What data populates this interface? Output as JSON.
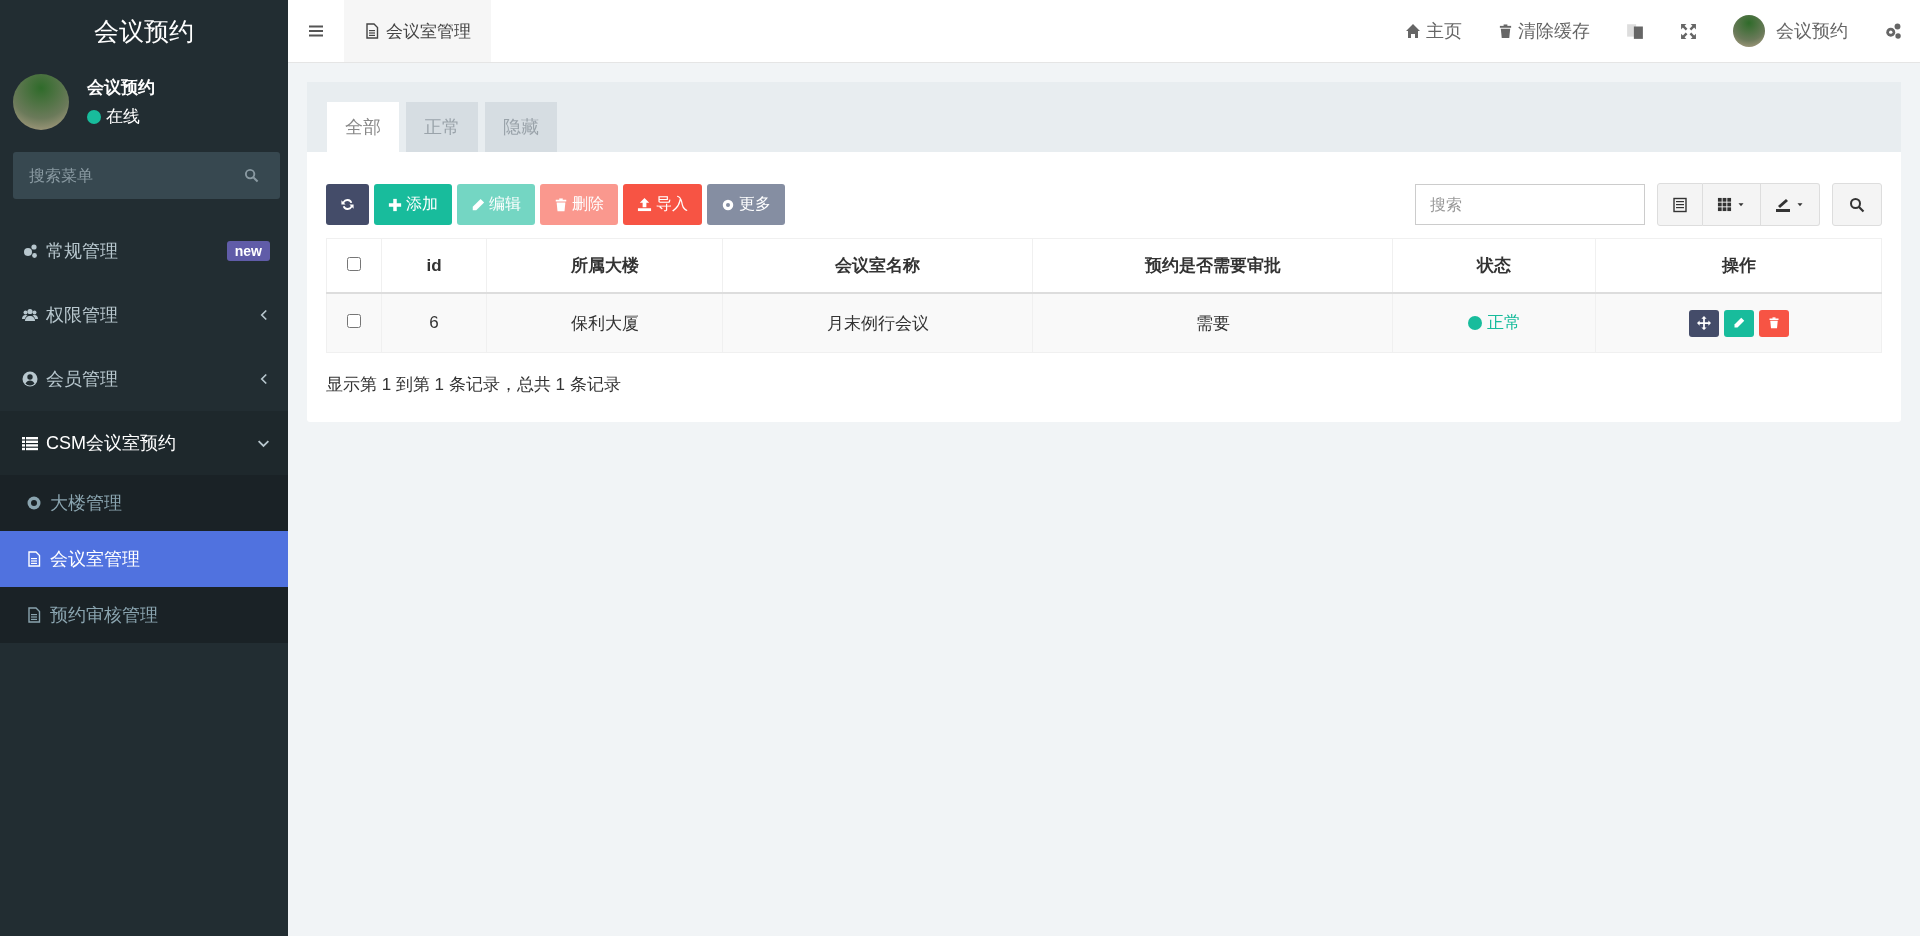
{
  "app": {
    "title": "会议预约"
  },
  "user": {
    "name": "会议预约",
    "status": "在线"
  },
  "sidebar": {
    "search": {
      "placeholder": "搜索菜单"
    },
    "items": [
      {
        "kind": "link",
        "label": "常规管理",
        "badge": "new"
      },
      {
        "kind": "group",
        "label": "权限管理",
        "expanded": false
      },
      {
        "kind": "group",
        "label": "会员管理",
        "expanded": false
      },
      {
        "kind": "group",
        "label": "CSM会议室预约",
        "expanded": true,
        "children": [
          {
            "label": "大楼管理",
            "selected": false
          },
          {
            "label": "会议室管理",
            "selected": true
          },
          {
            "label": "预约审核管理",
            "selected": false
          }
        ]
      }
    ]
  },
  "header": {
    "page_tab": "会议室管理",
    "links": [
      {
        "kind": "home",
        "label": "主页"
      },
      {
        "kind": "trash",
        "label": "清除缓存"
      },
      {
        "kind": "translate"
      },
      {
        "kind": "fullscreen"
      },
      {
        "kind": "user",
        "label": "会议预约"
      },
      {
        "kind": "settings"
      }
    ]
  },
  "tabs": [
    {
      "label": "全部",
      "selected": true
    },
    {
      "label": "正常",
      "selected": false
    },
    {
      "label": "隐藏",
      "selected": false
    }
  ],
  "toolbar": {
    "buttons": [
      {
        "kind": "refresh",
        "disabled": false
      },
      {
        "kind": "add",
        "label": "添加",
        "disabled": false
      },
      {
        "kind": "edit",
        "label": "编辑",
        "disabled": true
      },
      {
        "kind": "delete",
        "label": "删除",
        "disabled": true
      },
      {
        "kind": "import",
        "label": "导入",
        "disabled": false
      },
      {
        "kind": "more",
        "label": "更多",
        "disabled": false
      }
    ],
    "search": {
      "placeholder": "搜索"
    }
  },
  "table": {
    "header_checked": false,
    "columns": [
      "id",
      "所属大楼",
      "会议室名称",
      "预约是否需要审批",
      "状态",
      "操作"
    ],
    "rows": [
      {
        "checked": false,
        "cells": [
          "6",
          "保利大厦",
          "月末例行会议",
          "需要"
        ],
        "status": {
          "label": "正常",
          "color": "#18bc9c"
        }
      }
    ]
  },
  "footer": "显示第 1 到第 1 条记录，总共 1 条记录"
}
